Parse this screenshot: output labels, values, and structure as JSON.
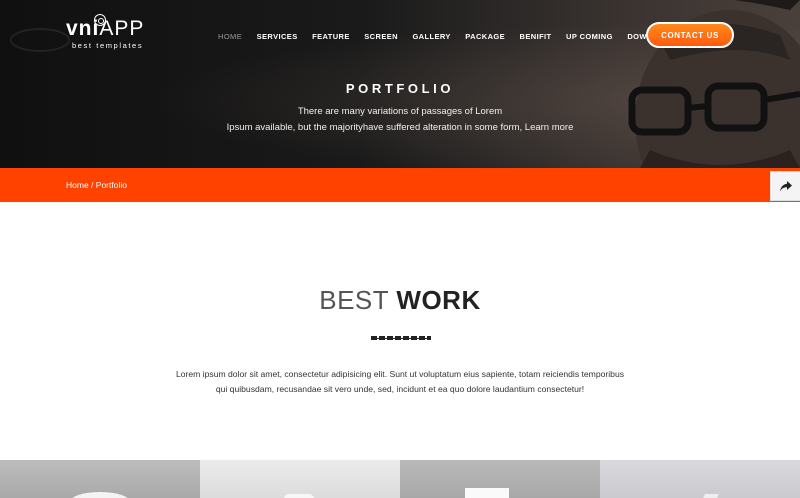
{
  "brand": {
    "name_part1": "vni",
    "name_part2": "APP",
    "tagline": "best templates"
  },
  "nav": {
    "items": [
      {
        "label": "HOME",
        "active": true
      },
      {
        "label": "SERVICES",
        "active": false
      },
      {
        "label": "FEATURE",
        "active": false
      },
      {
        "label": "SCREEN",
        "active": false
      },
      {
        "label": "GALLERY",
        "active": false
      },
      {
        "label": "PACKAGE",
        "active": false
      },
      {
        "label": "BENIFIT",
        "active": false
      },
      {
        "label": "UP COMING",
        "active": false
      },
      {
        "label": "DOWNLOAD APP",
        "active": false
      }
    ],
    "contact_label": "CONTACT US"
  },
  "hero": {
    "title": "PORTFOLIO",
    "desc_line1": "There are many variations of passages of Lorem",
    "desc_line2": "Ipsum available, but the majorityhave suffered alteration in some form, Learn more"
  },
  "breadcrumb": {
    "home": "Home",
    "separator": " / ",
    "current": "Portfolio"
  },
  "share": {
    "icon": "share-arrow-icon"
  },
  "section": {
    "title_light": "BEST ",
    "title_bold": "WORK",
    "desc_line1": "Lorem ipsum dolor sit amet, consectetur adipisicing elit. Sunt ut voluptatum eius sapiente, totam reiciendis temporibus",
    "desc_line2": "qui quibusdam, recusandae sit vero unde, sed, incidunt et ea quo dolore laudantium consectetur!"
  },
  "colors": {
    "accent": "#ff4200",
    "button": "#ff6a12",
    "hero_bg": "#151515"
  }
}
